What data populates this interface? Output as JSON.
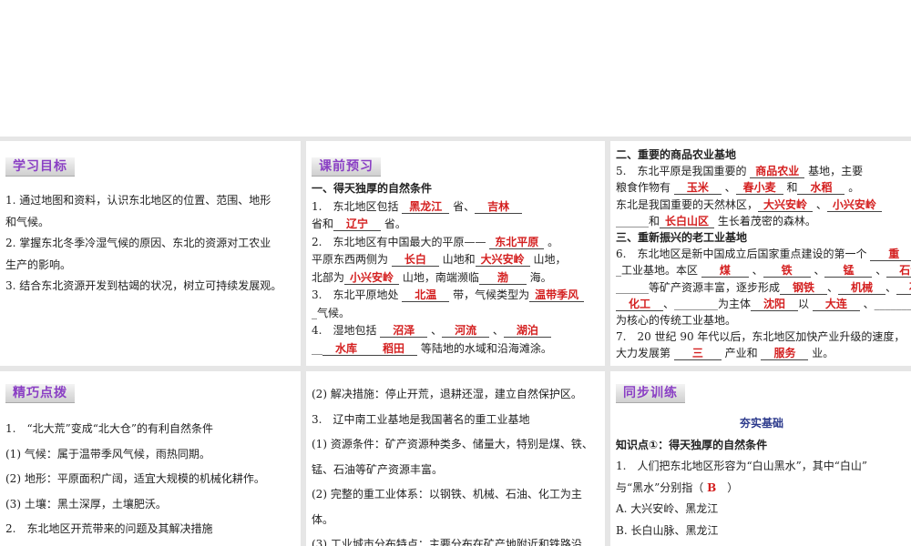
{
  "panels": [
    {
      "badge": "学习目标",
      "lines": [
        [
          {
            "t": "1. 通过地图和资料，认识东北地区的位置、范围、地形"
          }
        ],
        [
          {
            "t": "和气候。"
          }
        ],
        [
          {
            "t": "2. 掌握东北冬季冷湿气候的原因、东北的资源对工农业"
          }
        ],
        [
          {
            "t": "生产的影响。"
          }
        ],
        [
          {
            "t": "3. 结合东北资源开发到枯竭的状况，树立可持续发展观。"
          }
        ]
      ]
    },
    {
      "badge": "课前预习",
      "lines": [
        [
          {
            "t": "一、得天独厚的自然条件",
            "b": 1
          }
        ],
        [
          {
            "t": "1.　东北地区包括 "
          },
          {
            "a": "黑龙江"
          },
          {
            "t": " 省、"
          },
          {
            "a": "吉林"
          }
        ],
        [
          {
            "t": "省和"
          },
          {
            "a": "辽宁"
          },
          {
            "t": " 省。"
          }
        ],
        [
          {
            "t": "2.　东北地区有中国最大的平原—— "
          },
          {
            "a": "东北平原"
          },
          {
            "t": " 。"
          }
        ],
        [
          {
            "t": "平原东西两侧为 "
          },
          {
            "a": "长白"
          },
          {
            "t": " 山地和"
          },
          {
            "a": "大兴安岭"
          },
          {
            "t": " 山地，"
          }
        ],
        [
          {
            "t": "北部为"
          },
          {
            "a": "小兴安岭"
          },
          {
            "t": " 山地，南端濒临"
          },
          {
            "a": "渤"
          },
          {
            "t": " 海。"
          }
        ],
        [
          {
            "t": "3.　东北平原地处 "
          },
          {
            "a": "北温"
          },
          {
            "t": " 带，气候类型为"
          },
          {
            "a": "温带季风"
          }
        ],
        [
          {
            "t": "_气候。"
          }
        ],
        [
          {
            "t": "4.　湿地包括 "
          },
          {
            "a": "沼泽"
          },
          {
            "t": " 、"
          },
          {
            "a": "河流"
          },
          {
            "t": " 、"
          },
          {
            "a": "湖泊"
          }
        ],
        [
          {
            "t": "__"
          },
          {
            "a": "水库"
          },
          {
            "a": "稻田"
          },
          {
            "t": " 等陆地的水域和沿海滩涂。"
          }
        ]
      ]
    },
    {
      "badge": "",
      "lines": [
        [
          {
            "t": "二、重要的商品农业基地",
            "b": 1
          }
        ],
        [
          {
            "t": "5.　东北平原是我国重要的 "
          },
          {
            "a": "商品农业"
          },
          {
            "t": " 基地，主要"
          }
        ],
        [
          {
            "t": "粮食作物有 "
          },
          {
            "a": "玉米"
          },
          {
            "t": " 、"
          },
          {
            "a": "春小麦"
          },
          {
            "t": " 和"
          },
          {
            "a": "水稻"
          },
          {
            "t": " 。"
          }
        ],
        [
          {
            "t": "东北是我国重要的天然林区，"
          },
          {
            "a": "大兴安岭"
          },
          {
            "t": " 、"
          },
          {
            "a": "小兴安岭"
          }
        ],
        [
          {
            "t": "______和"
          },
          {
            "a": "长白山区"
          },
          {
            "t": " 生长着茂密的森林。"
          }
        ],
        [
          {
            "t": "三、重新振兴的老工业基地",
            "b": 1
          }
        ],
        [
          {
            "t": "6.　东北地区是新中国成立后国家重点建设的第一个 "
          },
          {
            "a": "重"
          }
        ],
        [
          {
            "t": "_工业基地。本区 "
          },
          {
            "a": "煤"
          },
          {
            "t": " 、"
          },
          {
            "a": "铁"
          },
          {
            "t": " 、"
          },
          {
            "a": "锰"
          },
          {
            "t": " 、"
          },
          {
            "a": "石油"
          }
        ],
        [
          {
            "t": "______等矿产资源丰富，逐步形成"
          },
          {
            "a": "钢铁"
          },
          {
            "t": "、"
          },
          {
            "a": "机械"
          },
          {
            "t": "、"
          },
          {
            "a": "石油"
          },
          {
            "t": "、"
          }
        ],
        [
          {
            "a": "化工"
          },
          {
            "t": "、________为主体"
          },
          {
            "a": "沈阳"
          },
          {
            "t": "以 "
          },
          {
            "a": "大连"
          },
          {
            "t": " 、________"
          }
        ],
        [
          {
            "t": "为核心的传统工业基地。"
          }
        ],
        [
          {
            "t": "7.　20 世纪 90 年代以后，东北地区加快产业升级的速度，"
          }
        ],
        [
          {
            "t": "大力发展第 "
          },
          {
            "a": "三"
          },
          {
            "t": " 产业和 "
          },
          {
            "a": "服务"
          },
          {
            "t": " 业。"
          }
        ]
      ]
    },
    {
      "badge": "精巧点拨",
      "lines": [
        [
          {
            "t": "1.　“北大荒”变成“北大仓”的有利自然条件"
          }
        ],
        [
          {
            "t": "(1) 气候：属于温带季风气候，雨热同期。"
          }
        ],
        [
          {
            "t": "(2) 地形：平原面积广阔，适宜大规模的机械化耕作。"
          }
        ],
        [
          {
            "t": "(3) 土壤：黑土深厚，土壤肥沃。"
          }
        ],
        [
          {
            "t": "2.　东北地区开荒带来的问题及其解决措施"
          }
        ]
      ]
    },
    {
      "badge": "",
      "lines": [
        [
          {
            "t": "(2) 解决措施：停止开荒，退耕还湿，建立自然保护区。"
          }
        ],
        [
          {
            "t": "3.　辽中南工业基地是我国著名的重工业基地"
          }
        ],
        [
          {
            "t": "(1) 资源条件：矿产资源种类多、储量大，特别是煤、铁、"
          }
        ],
        [
          {
            "t": "锰、石油等矿产资源丰富。"
          }
        ],
        [
          {
            "t": "(2) 完整的重工业体系：以钢铁、机械、石油、化工为主"
          }
        ],
        [
          {
            "t": "体。"
          }
        ],
        [
          {
            "t": "(3) 工业城市分布特点：主要分布在矿产地附近和铁路沿"
          }
        ]
      ]
    },
    {
      "badge": "同步训练",
      "lines": [
        [
          {
            "t": "夯实基础",
            "c": 1
          }
        ],
        [
          {
            "t": "知识点①：得天独厚的自然条件",
            "b": 1
          }
        ],
        [
          {
            "t": "1.　人们把东北地区形容为“白山黑水”，其中“白山”"
          }
        ],
        [
          {
            "t": "与“黑水”分别指（ "
          },
          {
            "r": "B"
          },
          {
            "t": "　）"
          }
        ],
        [
          {
            "t": "A. 大兴安岭、黑龙江"
          }
        ],
        [
          {
            "t": "B. 长白山脉、黑龙江"
          }
        ]
      ]
    }
  ]
}
